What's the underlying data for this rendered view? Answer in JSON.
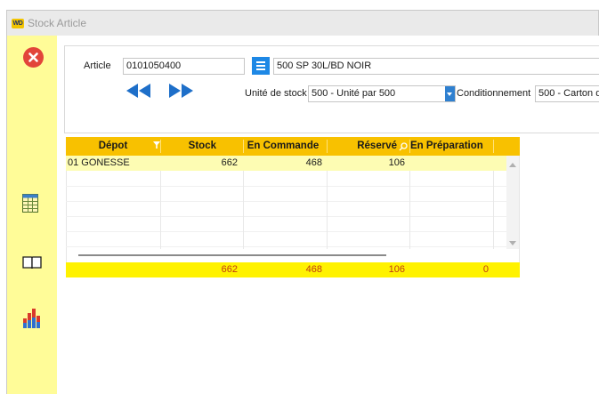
{
  "window": {
    "logo_text": "WD",
    "title": "Stock Article"
  },
  "toolbar": {
    "close_icon": "close-circle-icon",
    "items": [
      {
        "icon": "table-grid-icon"
      },
      {
        "icon": "open-book-icon"
      },
      {
        "icon": "bar-chart-icon"
      }
    ]
  },
  "article": {
    "label": "Article",
    "code": "0101050400",
    "description": "500 SP 30L/BD NOIR",
    "unit_label": "Unité de stock",
    "unit_value": "500 - Unité par 500",
    "packaging_label": "Conditionnement",
    "packaging_value": "500 - Carton d"
  },
  "grid": {
    "columns": [
      "Dépot",
      "Stock",
      "En Commande",
      "Réservé",
      "En Préparation"
    ],
    "rows": [
      {
        "depot": "01 GONESSE",
        "stock": "662",
        "en_commande": "468",
        "reserve": "106",
        "en_preparation": ""
      }
    ],
    "totals": {
      "stock": "662",
      "en_commande": "468",
      "reserve": "106",
      "en_preparation": "0"
    }
  },
  "colors": {
    "sidebar": "#fffc98",
    "grid_header": "#f8c100",
    "selected_row": "#fdfcb3",
    "totals_row": "#fff200",
    "totals_text": "#c03a12",
    "accent_blue": "#1e88e5",
    "close_red": "#e2453a"
  }
}
